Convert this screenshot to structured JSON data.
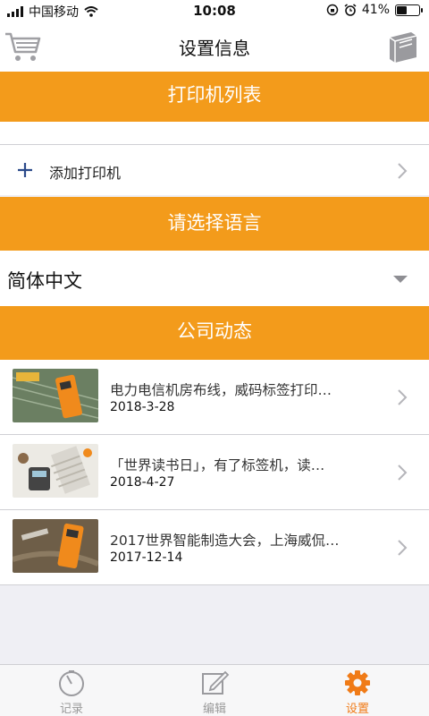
{
  "status_bar": {
    "carrier": "中国移动",
    "time": "10:08",
    "battery_percent": "41%",
    "battery_level": 0.41,
    "icons": [
      "signal-icon",
      "wifi-icon",
      "rotation-lock-icon",
      "alarm-icon",
      "battery-icon"
    ]
  },
  "nav": {
    "title": "设置信息",
    "left_icon": "cart-icon",
    "right_icon": "book-icon"
  },
  "printers": {
    "header": "打印机列表",
    "add_label": "添加打印机"
  },
  "language": {
    "header": "请选择语言",
    "selected": "简体中文"
  },
  "news": {
    "header": "公司动态",
    "items": [
      {
        "title": "电力电信机房布线，威码标签打印…",
        "date": "2018-3-28"
      },
      {
        "title": "「世界读书日」，有了标签机，读…",
        "date": "2018-4-27"
      },
      {
        "title": "2017世界智能制造大会，上海威侃…",
        "date": "2017-12-14"
      }
    ]
  },
  "tabs": [
    {
      "label": "记录",
      "icon": "clock-icon",
      "active": false
    },
    {
      "label": "编辑",
      "icon": "edit-icon",
      "active": false
    },
    {
      "label": "设置",
      "icon": "gear-icon",
      "active": true
    }
  ],
  "colors": {
    "accent": "#f39b1b",
    "active_tab": "#f07b17",
    "background": "#efeff4"
  }
}
